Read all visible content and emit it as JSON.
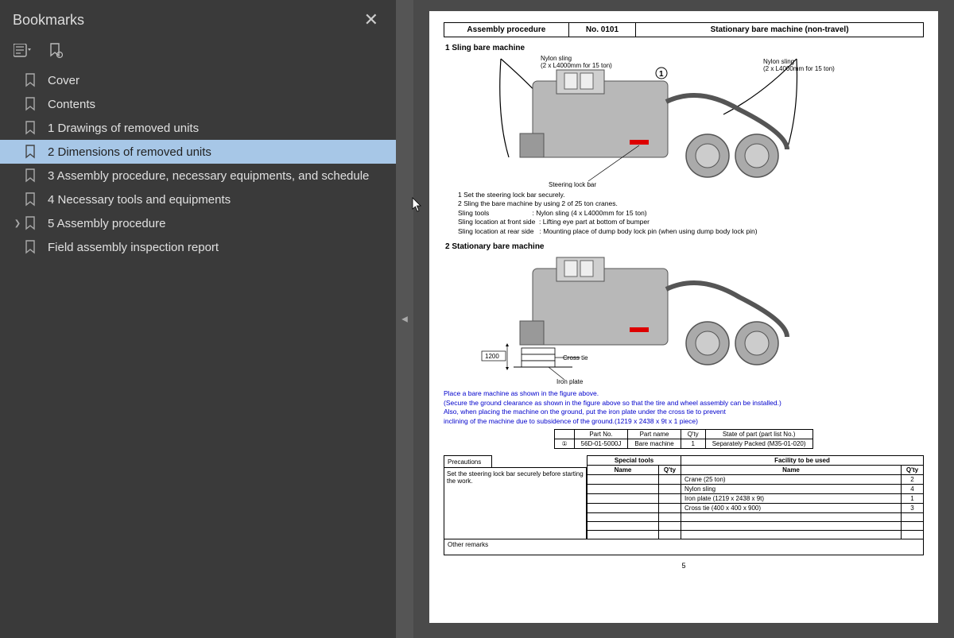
{
  "sidebar": {
    "title": "Bookmarks",
    "items": [
      {
        "label": "Cover",
        "selected": false,
        "hasChildren": false
      },
      {
        "label": "Contents",
        "selected": false,
        "hasChildren": false
      },
      {
        "label": "1 Drawings of removed units",
        "selected": false,
        "hasChildren": false
      },
      {
        "label": "2 Dimensions of removed units",
        "selected": true,
        "hasChildren": false
      },
      {
        "label": "3 Assembly procedure, necessary equipments, and schedule",
        "selected": false,
        "hasChildren": false
      },
      {
        "label": "4 Necessary tools and equipments",
        "selected": false,
        "hasChildren": false
      },
      {
        "label": "5 Assembly procedure",
        "selected": false,
        "hasChildren": true
      },
      {
        "label": "Field assembly inspection report",
        "selected": false,
        "hasChildren": false
      }
    ]
  },
  "doc": {
    "header": {
      "col1": "Assembly procedure",
      "col2": "No. 0101",
      "col3": "Stationary bare machine (non-travel)"
    },
    "sec1": {
      "title": "1 Sling bare machine",
      "callouts": {
        "nylon1": "Nylon sling",
        "nylon1b": "(2 x L4000mm for 15 ton)",
        "nylon2": "Nylon sling",
        "nylon2b": "(2 x L4000mm for 15 ton)",
        "lockbar": "Steering lock bar",
        "num1": "1"
      },
      "notes": [
        "1 Set the steering lock bar securely.",
        "2 Sling the bare machine by using 2 of 25 ton cranes.",
        "Sling tools                       : Nylon sling (4 x L4000mm for 15 ton)",
        "Sling location at front side  : Lifting eye part at bottom of bumper",
        "Sling location at rear side   : Mounting place of dump body lock pin (when using dump body lock pin)"
      ]
    },
    "sec2": {
      "title": "2 Stationary bare machine",
      "callouts": {
        "dim": "1200",
        "cross": "Cross tie",
        "iron": "Iron plate"
      },
      "bluenotes": [
        "Place a bare machine as shown in the figure above.",
        "(Secure the ground clearance as shown in the figure above so that the tire and wheel assembly can be installed.)",
        "Also, when placing the machine on the ground, put the iron plate under the cross tie to prevent",
        "inclining of the machine due to subsidence of the ground.(1219 x 2438 x 9t x 1 piece)"
      ]
    },
    "parts": {
      "headers": [
        "",
        "Part No.",
        "Part name",
        "Q'ty",
        "State of part (part list No.)"
      ],
      "row": [
        "①",
        "56D-01-5000J",
        "Bare machine",
        "1",
        "Separately Packed (M35-01-020)"
      ]
    },
    "precautions": {
      "header": "Precautions",
      "text": "Set the steering lock bar securely before starting the work."
    },
    "tools": {
      "h1": "Special tools",
      "h2": "Facility to be used",
      "sub1": "Name",
      "sub2": "Q'ty",
      "sub3": "Name",
      "sub4": "Q'ty",
      "rows": [
        [
          "",
          "",
          "Crane (25 ton)",
          "2"
        ],
        [
          "",
          "",
          "Nylon sling",
          "4"
        ],
        [
          "",
          "",
          "Iron plate (1219 x 2438 x 9t)",
          "1"
        ],
        [
          "",
          "",
          "Cross tie (400 x 400 x 900)",
          "3"
        ],
        [
          "",
          "",
          "",
          ""
        ],
        [
          "",
          "",
          "",
          ""
        ],
        [
          "",
          "",
          "",
          ""
        ]
      ]
    },
    "remarks": "Other remarks",
    "pagenum": "5"
  }
}
